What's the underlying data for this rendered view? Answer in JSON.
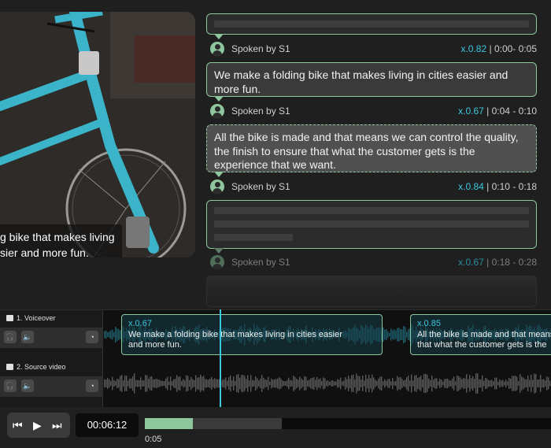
{
  "video": {
    "subtitle_line1": "g bike that makes living",
    "subtitle_line2": "sier and more fun."
  },
  "transcript": {
    "segments": [
      {
        "text": "",
        "speaker": "Spoken by S1",
        "speed": "x.0.82",
        "range": "0:00- 0:05"
      },
      {
        "text": "We make a folding bike that makes living in cities easier and more fun.",
        "speaker": "Spoken by S1",
        "speed": "x.0.67",
        "range": "0:04 - 0:10"
      },
      {
        "text": "All the bike is made and that means we can control the quality, the finish to ensure that what the customer gets is the experience that we want.",
        "speaker": "Spoken by S1",
        "speed": "x.0.84",
        "range": "0:10 - 0:18"
      },
      {
        "text": "",
        "speaker": "Spoken by S1",
        "speed": "x.0.67",
        "range": "0:18 - 0:28"
      }
    ],
    "separator": "|"
  },
  "timeline": {
    "tracks": [
      {
        "label": "1.  Voiceover",
        "clips": [
          {
            "speed": "x.0.67",
            "text1": "We make a folding bike that makes living in cities easier",
            "text2": "and more fun."
          },
          {
            "speed": "x.0.85",
            "text1": "All the bike is made and that means",
            "text2": "that what the customer gets is the"
          }
        ]
      },
      {
        "label": "2.  Source video"
      }
    ],
    "icons": {
      "headphones": "🎧",
      "speaker": "🔈",
      "clock": "◔"
    }
  },
  "player": {
    "rewind_icon": "⏮",
    "play_icon": "▶",
    "forward_icon": "⏭",
    "timecode": "00:06:12",
    "progress_label": "0:05",
    "progress_fraction": 0.118
  },
  "colors": {
    "accent_green": "#8fc79d",
    "accent_cyan": "#3cc6e0",
    "background": "#1f1f1f"
  }
}
